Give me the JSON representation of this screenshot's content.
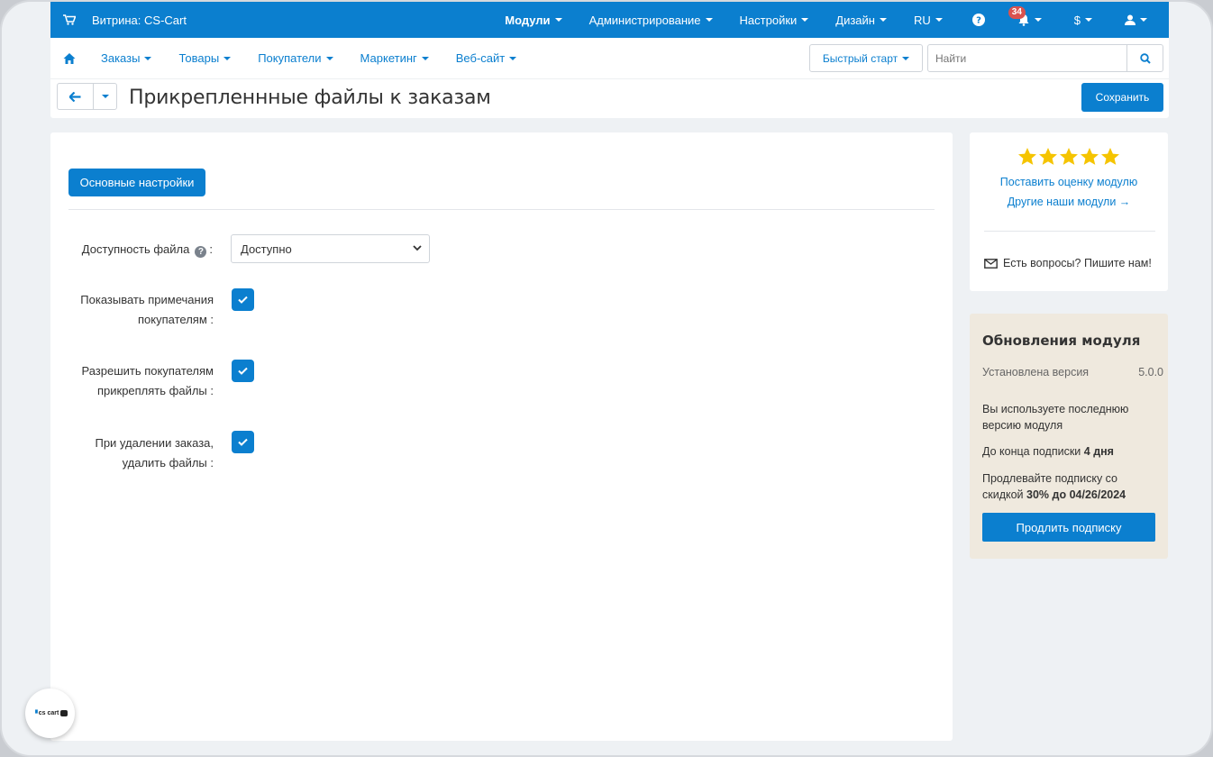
{
  "topbar": {
    "store_label": "Витрина: CS-Cart",
    "menu": [
      {
        "label": "Модули"
      },
      {
        "label": "Администрирование"
      },
      {
        "label": "Настройки"
      },
      {
        "label": "Дизайн"
      },
      {
        "label": "RU"
      }
    ],
    "notifications_count": "34",
    "currency": "$"
  },
  "subnav": {
    "items": [
      {
        "label": "Заказы"
      },
      {
        "label": "Товары"
      },
      {
        "label": "Покупатели"
      },
      {
        "label": "Маркетинг"
      },
      {
        "label": "Веб-сайт"
      }
    ],
    "quick_start": "Быстрый старт",
    "search_placeholder": "Найти"
  },
  "titlebar": {
    "title": "Прикрепленнные файлы к заказам",
    "save_label": "Сохранить"
  },
  "main": {
    "tab_label": "Основные настройки",
    "fields": {
      "file_availability_label": "Доступность файла",
      "file_availability_value": "Доступно",
      "show_notes_label": "Показывать примечания покупателям :",
      "allow_attach_label": "Разрешить покупателям прикреплять файлы :",
      "delete_files_label": "При удалении заказа, удалить файлы :"
    }
  },
  "sidebar": {
    "rating": {
      "stars": 5,
      "rate_link": "Поставить оценку модулю",
      "other_link": "Другие наши модули →",
      "contact": "Есть вопросы? Пишите нам!"
    },
    "updates": {
      "title": "Обновления модуля",
      "installed_label": "Установлена версия",
      "installed_version": "5.0.0",
      "latest_text": "Вы используете последнюю версию модуля",
      "sub_end_text": "До конца подписки",
      "sub_end_value": "4 дня",
      "promo_text": "Продлевайте подписку со скидкой",
      "promo_value": "30% до 04/26/2024",
      "renew_label": "Продлить подписку"
    }
  },
  "logo_text": "cs cart",
  "colors": {
    "accent": "#0b7fcf",
    "star": "#f5c400",
    "badge": "#d9534f",
    "updates_bg": "#efe9de"
  }
}
